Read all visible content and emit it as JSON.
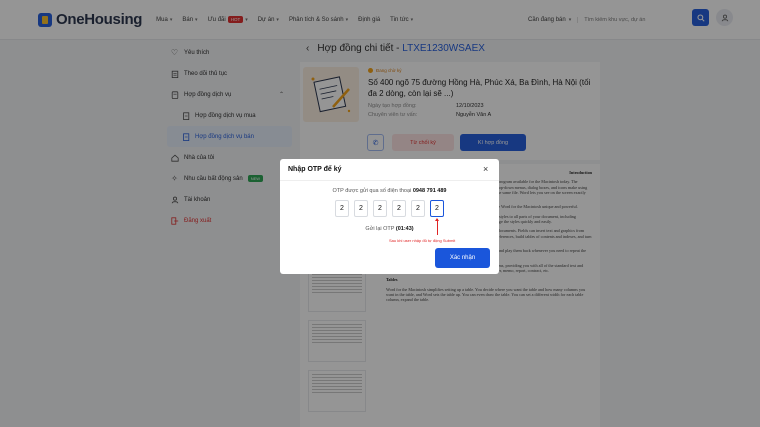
{
  "header": {
    "logo_text": "OneHousing",
    "nav": [
      {
        "label": "Mua",
        "has_caret": true
      },
      {
        "label": "Bán",
        "has_caret": true
      },
      {
        "label": "Ưu đãi",
        "badge": "HOT",
        "has_caret": true
      },
      {
        "label": "Dự án",
        "has_caret": true
      },
      {
        "label": "Phân tích & So sánh",
        "has_caret": true
      },
      {
        "label": "Định giá",
        "has_caret": false
      },
      {
        "label": "Tin tức",
        "has_caret": true
      }
    ],
    "search_type": "Cần đang bán",
    "search_placeholder": "Tìm kiếm khu vực, dự án"
  },
  "sidebar": {
    "items": [
      {
        "label": "Yêu thích",
        "icon": "heart-icon"
      },
      {
        "label": "Theo dõi thủ tục",
        "icon": "clipboard-icon"
      },
      {
        "label": "Hợp đồng dịch vụ",
        "icon": "contract-icon"
      },
      {
        "label": "Hợp đồng dịch vụ mua",
        "icon": "document-icon"
      },
      {
        "label": "Hợp đồng dịch vụ bán",
        "icon": "document-icon"
      },
      {
        "label": "Nhà của tôi",
        "icon": "home-icon"
      },
      {
        "label": "Nhu cầu bất động sản",
        "icon": "sparkle-icon",
        "badge": "NEW"
      },
      {
        "label": "Tài khoản",
        "icon": "user-icon"
      },
      {
        "label": "Đăng xuất",
        "icon": "logout-icon"
      }
    ]
  },
  "main": {
    "title_prefix": "Hợp đồng chi tiết - ",
    "title_code": "LTXE1230WSAEX",
    "status": "Đang chờ ký",
    "address": "Số 400 ngõ 75 đường Hồng Hà, Phúc Xá, Ba Đình, Hà Nội (tối đa 2 dòng, còn lại sẽ ...)",
    "meta": [
      {
        "label": "Ngày tạo hợp đồng:",
        "value": "12/10/2023"
      },
      {
        "label": "Chuyên viên tư vấn:",
        "value": "Nguyễn Văn A"
      }
    ],
    "reject_label": "Từ chối ký",
    "sign_label": "Kí hợp đồng",
    "doc": {
      "heading_partial": "Introduction",
      "intro": "Word for the Macintosh is the most sophisticated word processing program available for the Macintosh today. The graphical interface of the Macintosh exemplifies learning Word. Drop-down menus, dialog boxes, and icons make using Word's powerful features straightforward. Word lets you work on the same file. Word lets you see on the screen exactly what will print.",
      "p1": "Styles, fields, macros, and templates are the four Features that make Word for the Macintosh unique and powerful.",
      "bullets": [
        "Styles provide a way to format your document. Word applies styles to all parts of your document, including paragraphs, headings, and the table of contents. You can change the styles quickly and easily.",
        "Fields allow you to generate and update information in your documents. Fields can insert text and graphics from other files and programs, calculate page numbers and cross-references, build tables of contents and indexes, and turn tables into spreadsheets.",
        "Macros allow you to record a series of commands or actions and play them back whenever you need to repeat the same commands or actions.",
        "Templates are document models that work like preprinted forms, providing you with all of the standard text and formatting needed for a particular type of document (i.e., letter, memo, report, contract, etc."
      ],
      "tables_heading": "Tables",
      "tables_text": "Word for the Macintosh simplifies setting up a table. You decide where you want the table and how many columns you want in the table, and Word sets the table up. You can even draw the table. You can set a different width for each table column, expand the table."
    }
  },
  "modal": {
    "title": "Nhập OTP để ký",
    "sent_text": "OTP được gửi qua số điện thoại",
    "phone": "0948 791 489",
    "otp_digits": [
      "2",
      "2",
      "2",
      "2",
      "2",
      "2"
    ],
    "resend_text": "Gửi lại OTP",
    "countdown": "(01:43)",
    "note": "Sau khi user nhập đủ tự động Submit",
    "confirm_label": "Xác nhận"
  }
}
